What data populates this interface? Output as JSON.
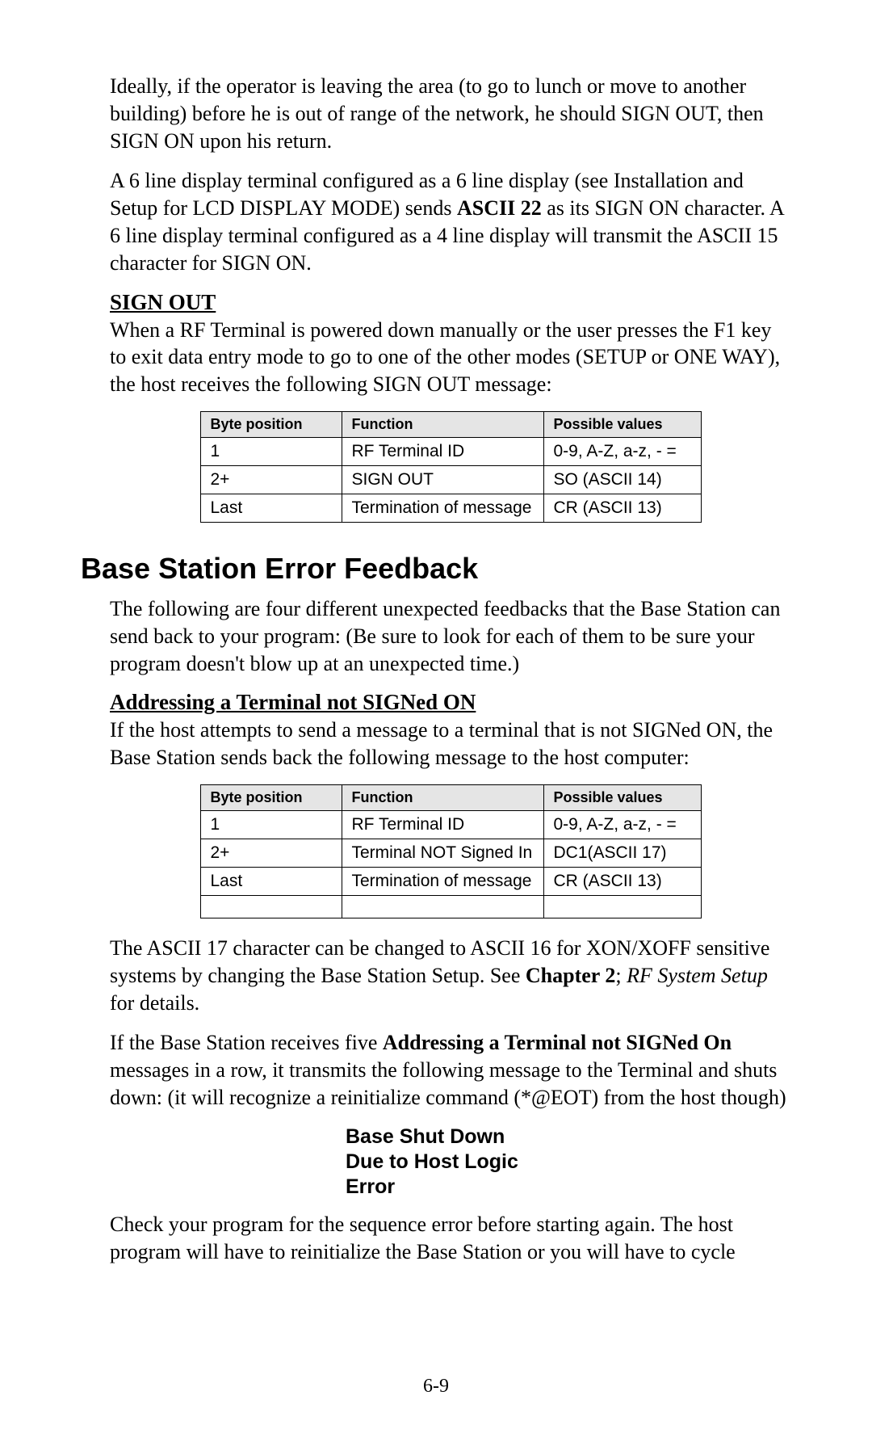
{
  "para1": "Ideally, if the operator is leaving the area (to go to lunch or move to another building) before he is out of range of the network, he should SIGN OUT, then SIGN ON upon his return.",
  "para2_prefix": "A 6 line display terminal configured as a 6 line display (see Installation and Setup for LCD DISPLAY MODE) sends ",
  "para2_bold": "ASCII 22",
  "para2_suffix": " as its SIGN ON character. A 6 line display terminal configured as a 4 line display will transmit the ASCII 15 character for SIGN ON.",
  "signout_heading": "SIGN OUT",
  "signout_para": "When a RF Terminal is powered down manually or the user presses the F1 key to exit data entry mode to go to one of the other modes (SETUP or ONE WAY), the host receives the following SIGN OUT message:",
  "table_headers": {
    "byte": "Byte position",
    "func": "Function",
    "val": "Possible values"
  },
  "table1": [
    {
      "byte": "1",
      "func": "RF Terminal ID",
      "val": "0-9, A-Z, a-z, - ="
    },
    {
      "byte": "2+",
      "func": "SIGN OUT",
      "val": "SO (ASCII 14)"
    },
    {
      "byte": "Last",
      "func": "Termination of message",
      "val": "CR (ASCII 13)"
    }
  ],
  "h2_title": "Base Station Error Feedback",
  "bsef_para": "The following are four different unexpected feedbacks that the Base Station can send back to your program: (Be sure to look for each of them to be sure your program doesn't blow up at an unexpected time.)",
  "addressing_heading": "Addressing a Terminal not SIGNed ON",
  "addressing_para": "If the host attempts to send a message to a terminal that is not SIGNed ON, the Base Station sends back the following message to the host computer:",
  "table2": [
    {
      "byte": "1",
      "func": "RF Terminal ID",
      "val": "0-9, A-Z, a-z, - ="
    },
    {
      "byte": "2+",
      "func": "Terminal NOT Signed In",
      "val": "DC1(ASCII 17)"
    },
    {
      "byte": "Last",
      "func": "Termination of message",
      "val": "CR (ASCII 13)"
    }
  ],
  "ascii17_prefix": "The ASCII 17 character can be changed to ASCII 16 for XON/XOFF sensitive systems by changing the Base Station Setup.  See ",
  "ascii17_bold": "Chapter 2",
  "ascii17_semi": "; ",
  "ascii17_italic": "RF System Setup",
  "ascii17_suffix": " for details.",
  "five_prefix": "If the Base Station receives five ",
  "five_bold": "Addressing a Terminal not SIGNed On",
  "five_suffix": " messages in a row, it transmits the following message to the Terminal and shuts down: (it will recognize a reinitialize command (*@EOT) from the host though)",
  "shutdown_line1": "Base Shut Down",
  "shutdown_line2": "Due to Host Logic",
  "shutdown_line3": "Error",
  "check_para": "Check your program for the sequence error before starting again. The host program will have to reinitialize the Base Station or you will have to cycle",
  "page_num": "6-9"
}
